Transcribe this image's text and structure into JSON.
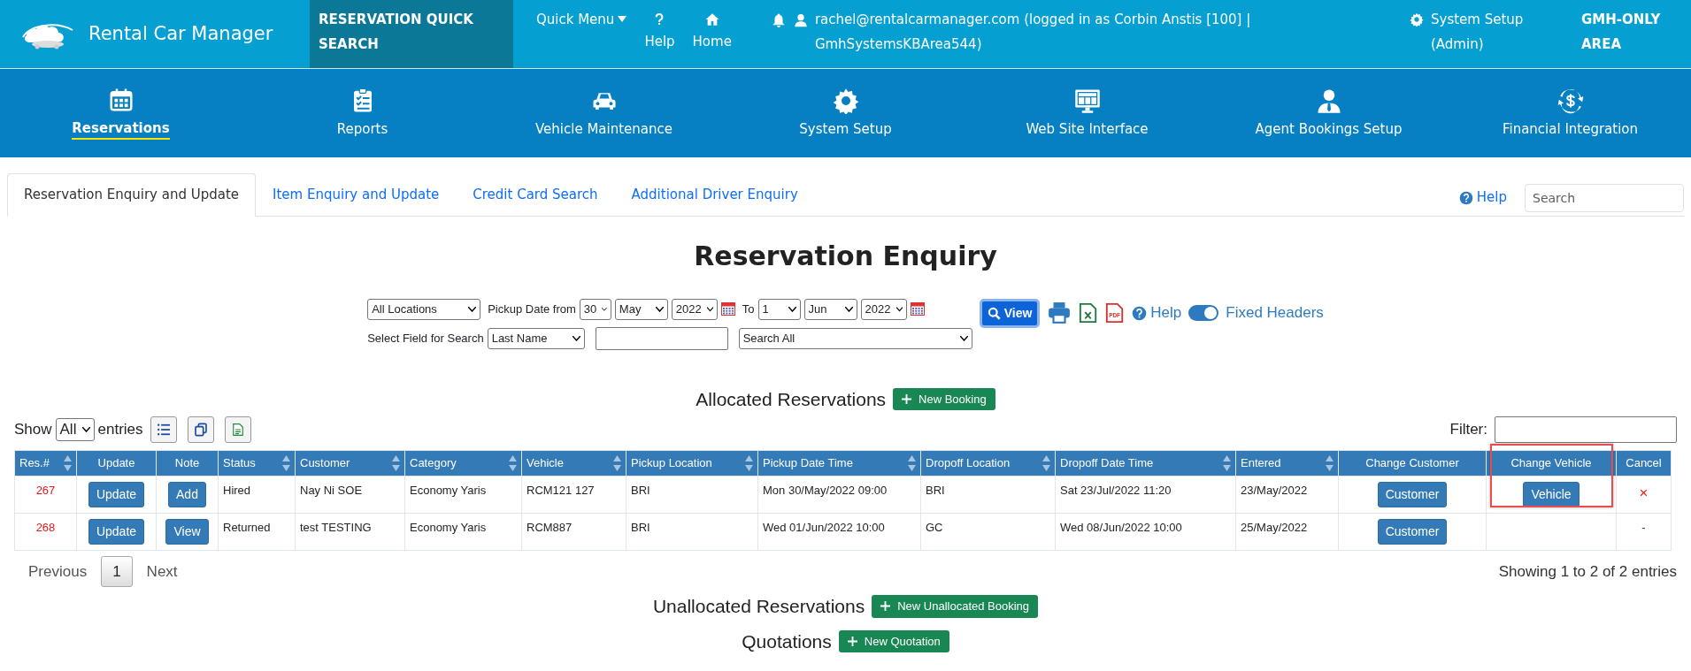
{
  "top_bar": {
    "brand": "Rental Car Manager",
    "quick_search": "RESERVATION QUICK SEARCH",
    "quick_menu": "Quick Menu",
    "help": "Help",
    "home": "Home",
    "user": "rachel@rentalcarmanager.com (logged in as Corbin Anstis [100] | GmhSystemsKBArea544)",
    "system_setup": "System Setup (Admin)",
    "area": "GMH-ONLY AREA"
  },
  "main_nav": [
    {
      "label": "Reservations",
      "selected": true
    },
    {
      "label": "Reports",
      "selected": false
    },
    {
      "label": "Vehicle Maintenance",
      "selected": false
    },
    {
      "label": "System Setup",
      "selected": false
    },
    {
      "label": "Web Site Interface",
      "selected": false
    },
    {
      "label": "Agent Bookings Setup",
      "selected": false
    },
    {
      "label": "Financial Integration",
      "selected": false
    }
  ],
  "tabs": [
    {
      "label": "Reservation Enquiry and Update",
      "selected": true
    },
    {
      "label": "Item Enquiry and Update",
      "selected": false
    },
    {
      "label": "Credit Card Search",
      "selected": false
    },
    {
      "label": "Additional Driver Enquiry",
      "selected": false
    }
  ],
  "tab_help": "Help",
  "search": {
    "placeholder": "Search"
  },
  "page_title": "Reservation Enquiry",
  "filters": {
    "location": "All Locations",
    "pickup_label": "Pickup Date from",
    "from_day": "30",
    "from_month": "May",
    "from_year": "2022",
    "to_label": "To",
    "to_day": "1",
    "to_month": "Jun",
    "to_year": "2022",
    "view": "View",
    "pdf_icon_text": "PDF",
    "help": "Help",
    "fixed_headers": {
      "label": "Fixed Headers",
      "on": true
    },
    "field_label": "Select Field for Search",
    "field": "Last Name",
    "scope": "Search All"
  },
  "allocated": {
    "title": "Allocated Reservations",
    "button": "New Booking",
    "show": "Show",
    "entries_value": "All",
    "entries": "entries",
    "filter": "Filter:",
    "columns": [
      {
        "label": "Res.#",
        "sortable": true,
        "highlighted": false
      },
      {
        "label": "Update",
        "sortable": false,
        "highlighted": false
      },
      {
        "label": "Note",
        "sortable": false,
        "highlighted": false
      },
      {
        "label": "Status",
        "sortable": true,
        "highlighted": false
      },
      {
        "label": "Customer",
        "sortable": true,
        "highlighted": false
      },
      {
        "label": "Category",
        "sortable": true,
        "highlighted": false
      },
      {
        "label": "Vehicle",
        "sortable": true,
        "highlighted": false
      },
      {
        "label": "Pickup Location",
        "sortable": true,
        "highlighted": false
      },
      {
        "label": "Pickup Date Time",
        "sortable": true,
        "highlighted": false
      },
      {
        "label": "Dropoff Location",
        "sortable": true,
        "highlighted": false
      },
      {
        "label": "Dropoff Date Time",
        "sortable": true,
        "highlighted": false
      },
      {
        "label": "Entered",
        "sortable": true,
        "highlighted": false
      },
      {
        "label": "Change Customer",
        "sortable": false,
        "highlighted": false
      },
      {
        "label": "Change Vehicle",
        "sortable": false,
        "highlighted": true
      },
      {
        "label": "Cancel",
        "sortable": false,
        "highlighted": false
      }
    ],
    "rows": [
      {
        "res_no": "267",
        "update": "Update",
        "note": "Add",
        "status": "Hired",
        "customer": "Nay Ni SOE",
        "category": "Economy Yaris",
        "vehicle": "RCM121 127",
        "pickup_location": "BRI",
        "pickup_time": "Mon 30/May/2022 09:00",
        "dropoff_location": "BRI",
        "dropoff_time": "Sat 23/Jul/2022 11:20",
        "entered": "23/May/2022",
        "change_customer": "Customer",
        "change_vehicle": "Vehicle",
        "cancel": "×",
        "cancelable": true
      },
      {
        "res_no": "268",
        "update": "Update",
        "note": "View",
        "status": "Returned",
        "customer": "test TESTING",
        "category": "Economy Yaris",
        "vehicle": "RCM887",
        "pickup_location": "BRI",
        "pickup_time": "Wed 01/Jun/2022 10:00",
        "dropoff_location": "GC",
        "dropoff_time": "Wed 08/Jun/2022 10:00",
        "entered": "25/May/2022",
        "change_customer": "Customer",
        "cancel": "-",
        "cancelable": false
      }
    ],
    "previous": "Previous",
    "page": "1",
    "next": "Next",
    "info": "Showing 1 to 2 of 2 entries"
  },
  "unallocated": {
    "title": "Unallocated Reservations",
    "button": "New Unallocated Booking"
  },
  "quotations": {
    "title": "Quotations",
    "button": "New Quotation"
  }
}
